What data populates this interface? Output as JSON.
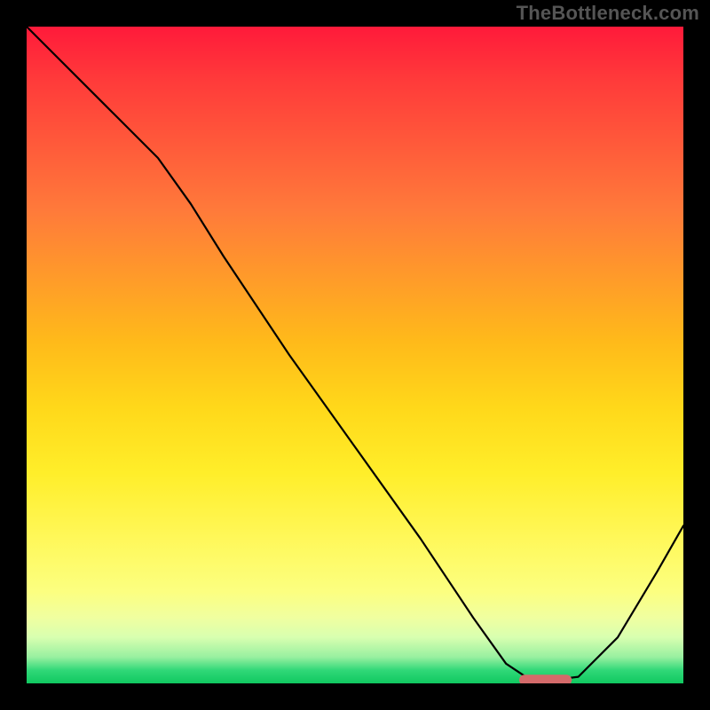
{
  "watermark": "TheBottleneck.com",
  "chart_data": {
    "type": "line",
    "title": "",
    "xlabel": "",
    "ylabel": "",
    "xlim": [
      0,
      100
    ],
    "ylim": [
      0,
      100
    ],
    "grid": false,
    "series": [
      {
        "name": "bottleneck-curve",
        "x": [
          0,
          5,
          12,
          20,
          25,
          30,
          40,
          50,
          60,
          68,
          73,
          76,
          80,
          84,
          90,
          96,
          100
        ],
        "values": [
          100,
          95,
          88,
          80,
          73,
          65,
          50,
          36,
          22,
          10,
          3,
          1,
          0.5,
          1,
          7,
          17,
          24
        ]
      }
    ],
    "marker": {
      "name": "optimal-range",
      "x_start": 75,
      "x_end": 83,
      "y": 0.5,
      "color": "#d46a6a"
    },
    "background_gradient": {
      "top": "#ff1a3a",
      "mid": "#ffd81a",
      "bottom": "#10c860"
    }
  }
}
